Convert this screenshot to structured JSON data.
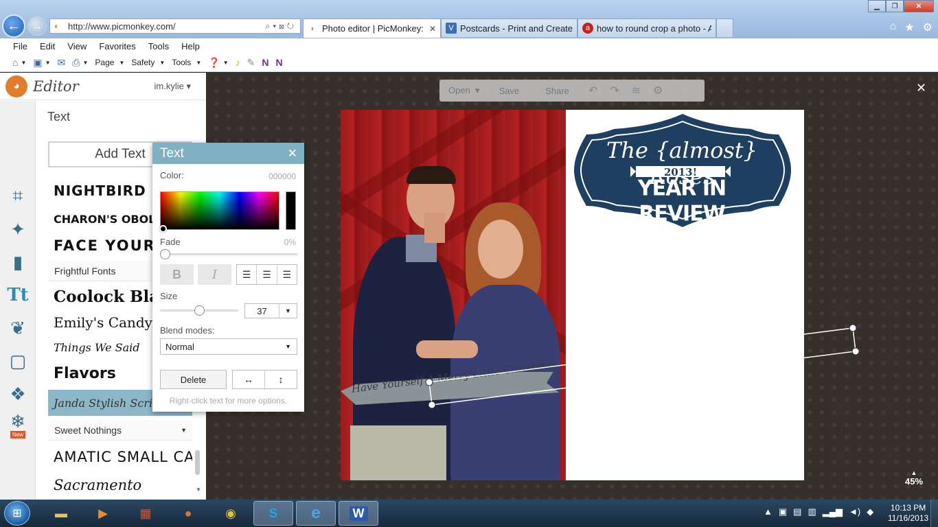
{
  "browser": {
    "url": "http://www.picmonkey.com/",
    "tabs": [
      {
        "label": "Photo editor | PicMonkey: F...",
        "active": true
      },
      {
        "label": "Postcards - Print and Create C...",
        "active": false
      },
      {
        "label": "how to round crop a photo - A...",
        "active": false
      }
    ],
    "menu": [
      "File",
      "Edit",
      "View",
      "Favorites",
      "Tools",
      "Help"
    ],
    "command_bar": {
      "page": "Page",
      "safety": "Safety",
      "tools": "Tools"
    }
  },
  "editor": {
    "title": "Editor",
    "user": "im.kylie",
    "panel_title": "Text",
    "add_text_label": "Add Text",
    "fonts": [
      {
        "name": "NIGHTBIRD"
      },
      {
        "name": "CHARON'S OBOL"
      },
      {
        "name": "FACE YOUR FEARS"
      }
    ],
    "category_frightful": "Frightful Fonts",
    "fonts2": [
      {
        "name": "Coolock Black"
      },
      {
        "name": "Emily's Candy"
      },
      {
        "name": "Things We Said"
      },
      {
        "name": "Flavors"
      },
      {
        "name": "Janda Stylish Script"
      }
    ],
    "category_sweet": "Sweet Nothings",
    "fonts3": [
      {
        "name": "AMATIC SMALL CAPS"
      },
      {
        "name": "Sacramento"
      }
    ],
    "new_badge": "New"
  },
  "text_dialog": {
    "title": "Text",
    "color_label": "Color:",
    "color_value": "000000",
    "fade_label": "Fade",
    "fade_value": "0%",
    "bold": "B",
    "italic": "I",
    "size_label": "Size",
    "size_value": "37",
    "size_fraction": 0.5,
    "blend_label": "Blend modes:",
    "blend_value": "Normal",
    "delete_label": "Delete",
    "hint": "Right-click text for more options."
  },
  "canvas_toolbar": {
    "open": "Open",
    "save": "Save",
    "share": "Share"
  },
  "card": {
    "title": "The {almost} Roses",
    "year": "2013!",
    "subtitle": "YEAR IN REVIEW",
    "banner": "Have Yourself A Merry Little Christmas"
  },
  "zoom": "45%",
  "taskbar": {
    "time": "10:13 PM",
    "date": "11/16/2013"
  },
  "colors": {
    "accent": "#7fb1c2",
    "badge_navy": "#1e3f5f"
  }
}
